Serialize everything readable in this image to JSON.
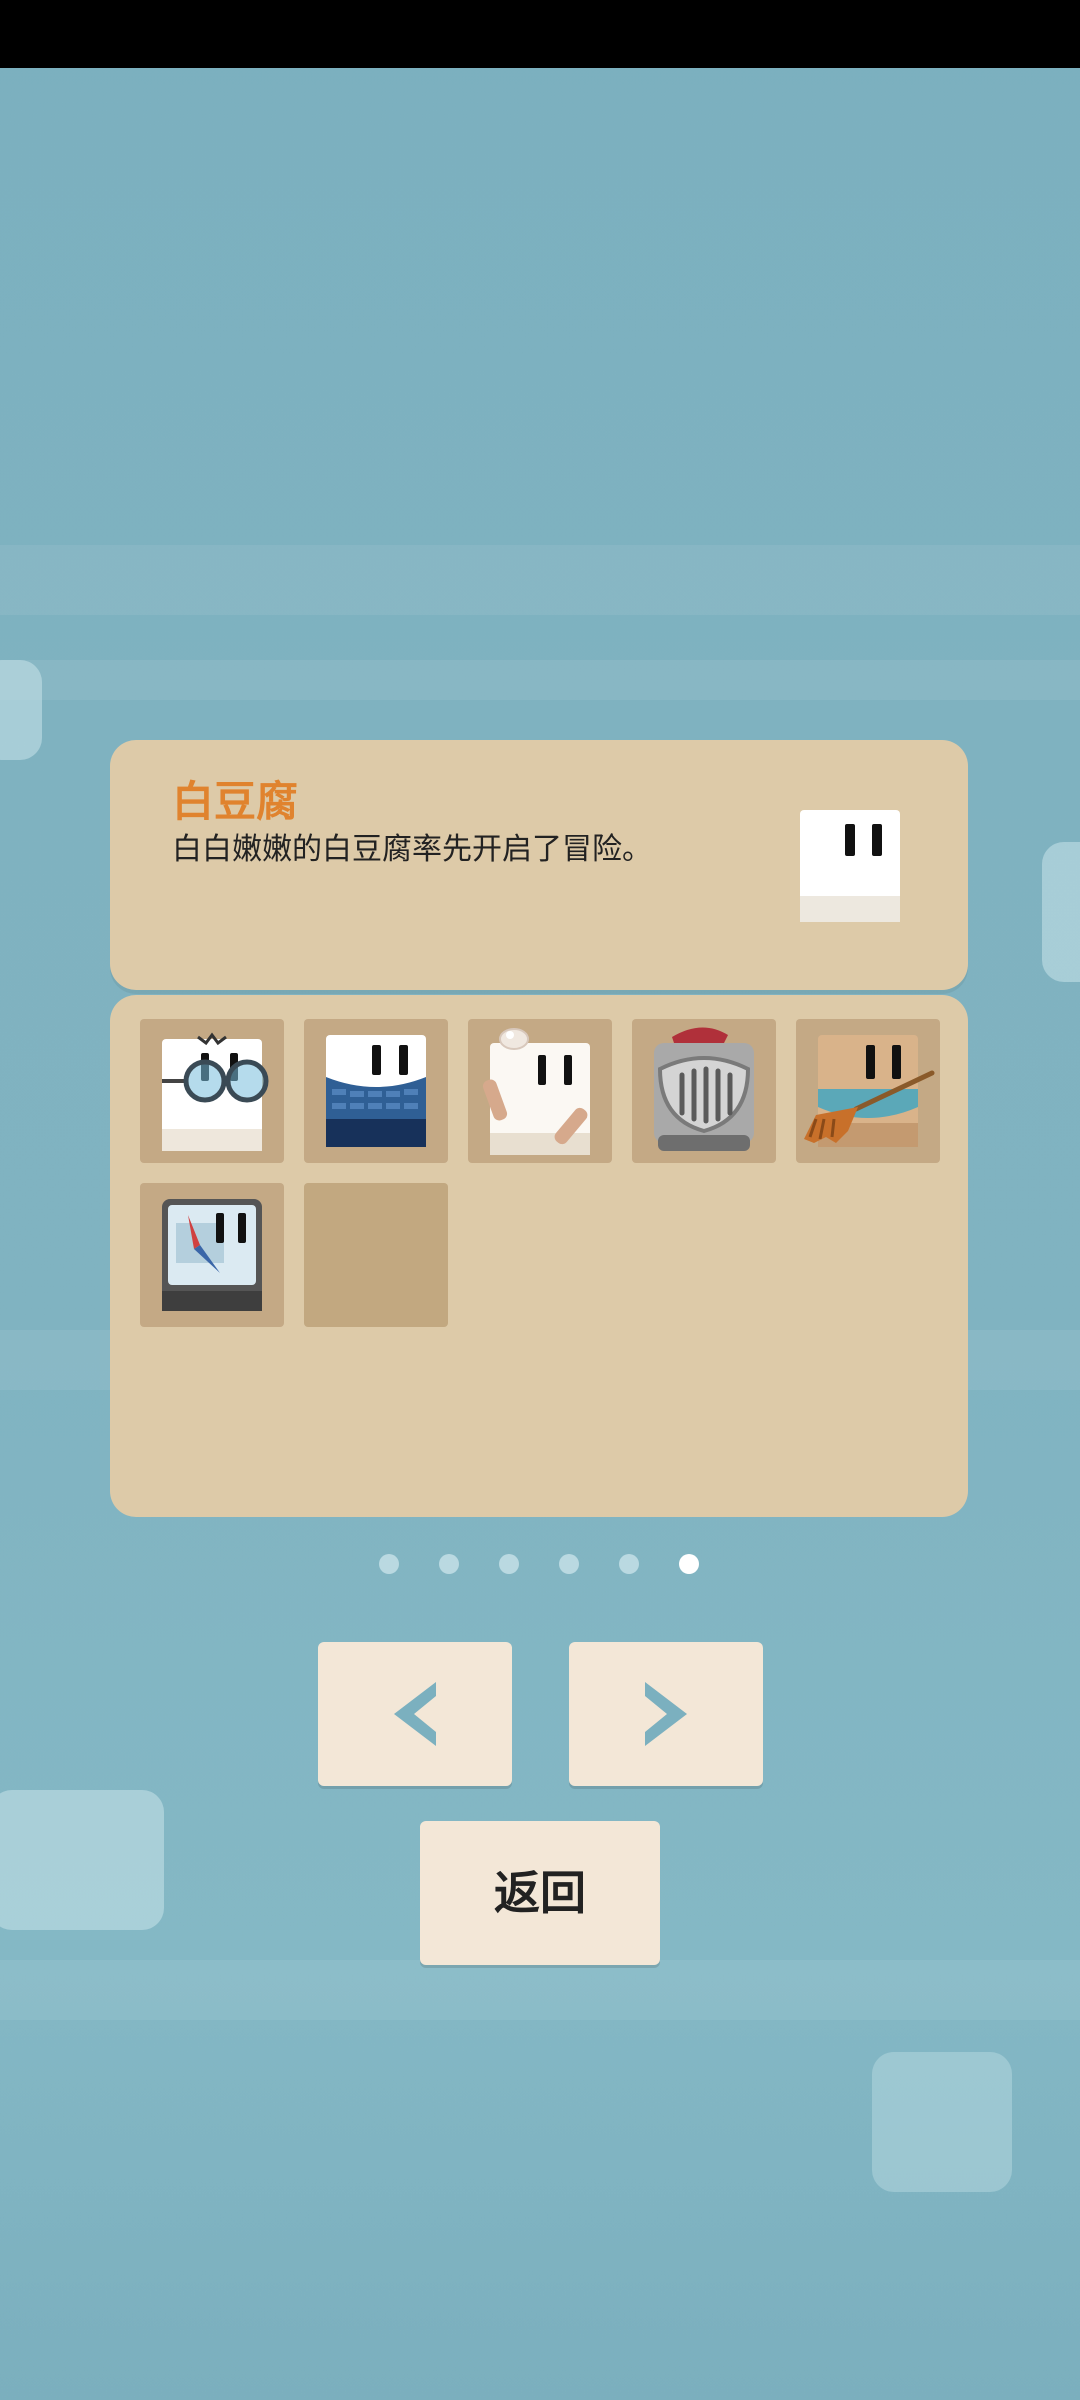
{
  "character": {
    "name": "白豆腐",
    "description": "白白嫩嫩的白豆腐率先开启了冒险。"
  },
  "skins": [
    {
      "name": "glasses-tofu-icon"
    },
    {
      "name": "sweater-tofu-icon"
    },
    {
      "name": "bandaged-tofu-icon"
    },
    {
      "name": "knight-helmet-tofu-icon"
    },
    {
      "name": "broom-tofu-icon"
    },
    {
      "name": "compass-tofu-icon"
    },
    {
      "name": "empty-slot"
    }
  ],
  "pagination": {
    "total_pages": 6,
    "current_page": 6
  },
  "buttons": {
    "prev_icon": "chevron-left-icon",
    "next_icon": "chevron-right-icon",
    "back_label": "返回"
  },
  "colors": {
    "panel": "#ddcaa8",
    "slot": "#c4a985",
    "title": "#e0832e",
    "button": "#f3e7d7",
    "arrow": "#7bb0bf"
  }
}
